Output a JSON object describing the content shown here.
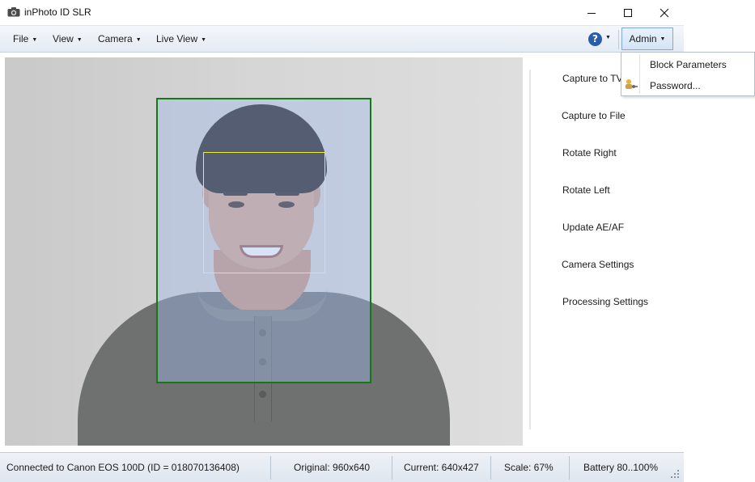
{
  "window": {
    "title": "inPhoto ID SLR",
    "icon": "camera-icon"
  },
  "menu": {
    "file": "File",
    "view": "View",
    "camera": "Camera",
    "live_view": "Live View",
    "help_icon": "help-icon",
    "admin": "Admin"
  },
  "admin_menu": {
    "items": [
      "Block Parameters",
      "Password..."
    ]
  },
  "actions": {
    "capture_tv": "Capture to TV",
    "capture_file": "Capture to File",
    "rotate_right": "Rotate Right",
    "rotate_left": "Rotate Left",
    "update_aeaf": "Update AE/AF",
    "camera_settings": "Camera Settings",
    "processing_settings": "Processing Settings"
  },
  "status": {
    "connection": "Connected to Canon EOS 100D (ID = 018070136408)",
    "original": "Original: 960x640",
    "current": "Current: 640x427",
    "scale": "Scale: 67%",
    "battery": "Battery 80..100%"
  },
  "colors": {
    "face_frame": "#137a13",
    "eyes_frame": "#f2ee2a",
    "crop_overlay": "#a0b9eb",
    "admin_highlight": "#d4e4f6"
  }
}
